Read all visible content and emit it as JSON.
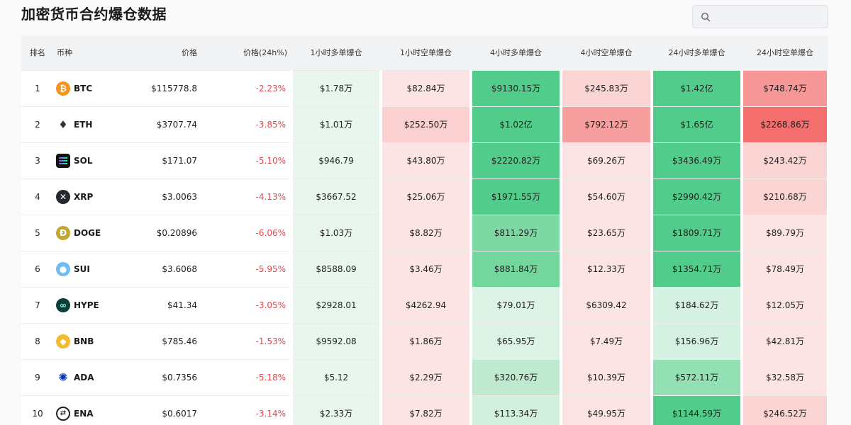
{
  "page": {
    "title": "加密货币合约爆仓数据"
  },
  "search": {
    "placeholder": "",
    "value": ""
  },
  "table": {
    "headers": {
      "rank": "排名",
      "coin": "币种",
      "price": "价格",
      "change": "价格(24h%)",
      "h1_long": "1小时多单爆仓",
      "h1_short": "1小时空单爆仓",
      "h4_long": "4小时多单爆仓",
      "h4_short": "4小时空单爆仓",
      "h24_long": "24小时多单爆仓",
      "h24_short": "24小时空单爆仓"
    },
    "rows": [
      {
        "rank": "1",
        "coin": "BTC",
        "icon": "bitcoin-icon",
        "price": "$115778.8",
        "change": "-2.23%",
        "h1_long": "$1.78万",
        "h1_short": "$82.84万",
        "h4_long": "$9130.15万",
        "h4_short": "$245.83万",
        "h24_long": "$1.42亿",
        "h24_short": "$748.74万"
      },
      {
        "rank": "2",
        "coin": "ETH",
        "icon": "ethereum-icon",
        "price": "$3707.74",
        "change": "-3.85%",
        "h1_long": "$1.01万",
        "h1_short": "$252.50万",
        "h4_long": "$1.02亿",
        "h4_short": "$792.12万",
        "h24_long": "$1.65亿",
        "h24_short": "$2268.86万"
      },
      {
        "rank": "3",
        "coin": "SOL",
        "icon": "solana-icon",
        "price": "$171.07",
        "change": "-5.10%",
        "h1_long": "$946.79",
        "h1_short": "$43.80万",
        "h4_long": "$2220.82万",
        "h4_short": "$69.26万",
        "h24_long": "$3436.49万",
        "h24_short": "$243.42万"
      },
      {
        "rank": "4",
        "coin": "XRP",
        "icon": "xrp-icon",
        "price": "$3.0063",
        "change": "-4.13%",
        "h1_long": "$3667.52",
        "h1_short": "$25.06万",
        "h4_long": "$1971.55万",
        "h4_short": "$54.60万",
        "h24_long": "$2990.42万",
        "h24_short": "$210.68万"
      },
      {
        "rank": "5",
        "coin": "DOGE",
        "icon": "dogecoin-icon",
        "price": "$0.20896",
        "change": "-6.06%",
        "h1_long": "$1.03万",
        "h1_short": "$8.82万",
        "h4_long": "$811.29万",
        "h4_short": "$23.65万",
        "h24_long": "$1809.71万",
        "h24_short": "$89.79万"
      },
      {
        "rank": "6",
        "coin": "SUI",
        "icon": "sui-icon",
        "price": "$3.6068",
        "change": "-5.95%",
        "h1_long": "$8588.09",
        "h1_short": "$3.46万",
        "h4_long": "$881.84万",
        "h4_short": "$12.33万",
        "h24_long": "$1354.71万",
        "h24_short": "$78.49万"
      },
      {
        "rank": "7",
        "coin": "HYPE",
        "icon": "hyperliquid-icon",
        "price": "$41.34",
        "change": "-3.05%",
        "h1_long": "$2928.01",
        "h1_short": "$4262.94",
        "h4_long": "$79.01万",
        "h4_short": "$6309.42",
        "h24_long": "$184.62万",
        "h24_short": "$12.05万"
      },
      {
        "rank": "8",
        "coin": "BNB",
        "icon": "bnb-icon",
        "price": "$785.46",
        "change": "-1.53%",
        "h1_long": "$9592.08",
        "h1_short": "$1.86万",
        "h4_long": "$65.95万",
        "h4_short": "$7.49万",
        "h24_long": "$156.96万",
        "h24_short": "$42.81万"
      },
      {
        "rank": "9",
        "coin": "ADA",
        "icon": "cardano-icon",
        "price": "$0.7356",
        "change": "-5.18%",
        "h1_long": "$5.12",
        "h1_short": "$2.29万",
        "h4_long": "$320.76万",
        "h4_short": "$10.39万",
        "h24_long": "$572.11万",
        "h24_short": "$32.58万"
      },
      {
        "rank": "10",
        "coin": "ENA",
        "icon": "ethena-icon",
        "price": "$0.6017",
        "change": "-3.14%",
        "h1_long": "$2.33万",
        "h1_short": "$7.82万",
        "h4_long": "$113.34万",
        "h4_short": "$49.95万",
        "h24_long": "$1144.59万",
        "h24_short": "$246.52万"
      }
    ],
    "cell_colors": [
      [
        "#e8f6ee",
        "#fce4e4",
        "#52cc8a",
        "#fbd4d4",
        "#52cc8a",
        "#f79696"
      ],
      [
        "#e8f6ee",
        "#fbd0d0",
        "#52cc8a",
        "#f79e9e",
        "#52cc8a",
        "#f56e6e"
      ],
      [
        "#e8f6ee",
        "#fce4e4",
        "#52cc8a",
        "#fce4e4",
        "#52cc8a",
        "#fbd4d4"
      ],
      [
        "#e8f6ee",
        "#fce4e4",
        "#52cc8a",
        "#fce4e4",
        "#52cc8a",
        "#fbd4d4"
      ],
      [
        "#e8f6ee",
        "#fce4e4",
        "#7cd9a4",
        "#fce4e4",
        "#52cc8a",
        "#fce4e4"
      ],
      [
        "#e8f6ee",
        "#fce4e4",
        "#72d69d",
        "#fce4e4",
        "#52cc8a",
        "#fce4e4"
      ],
      [
        "#e8f6ee",
        "#fce4e4",
        "#ddf3e6",
        "#fce4e4",
        "#d5f1e1",
        "#fce4e4"
      ],
      [
        "#e8f6ee",
        "#fce4e4",
        "#ddf3e6",
        "#fce4e4",
        "#d5f1e1",
        "#fce4e4"
      ],
      [
        "#e8f6ee",
        "#fce4e4",
        "#bfeacf",
        "#fce4e4",
        "#94e0b5",
        "#fce4e4"
      ],
      [
        "#e8f6ee",
        "#fce4e4",
        "#d3f0df",
        "#fce4e4",
        "#52cc8a",
        "#fbd4d4"
      ]
    ]
  }
}
